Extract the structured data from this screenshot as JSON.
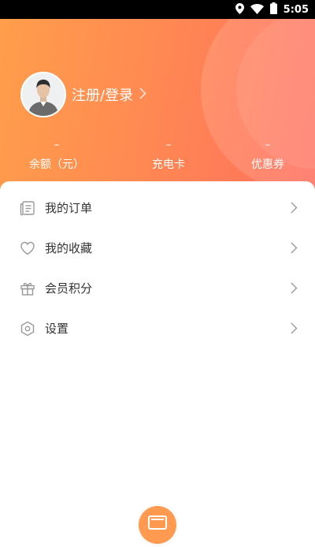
{
  "status_bar": {
    "time": "5:05",
    "icons": [
      "location-icon",
      "wifi-icon",
      "battery-icon"
    ]
  },
  "profile": {
    "login_label": "注册/登录",
    "avatar_icon": "user-avatar-icon"
  },
  "stats": [
    {
      "value": "–",
      "label": "余额（元）"
    },
    {
      "value": "–",
      "label": "充电卡"
    },
    {
      "value": "–",
      "label": "优惠券"
    }
  ],
  "menu": [
    {
      "label": "我的订单",
      "icon": "orders-icon"
    },
    {
      "label": "我的收藏",
      "icon": "heart-icon"
    },
    {
      "label": "会员积分",
      "icon": "gift-icon"
    },
    {
      "label": "设置",
      "icon": "settings-icon"
    }
  ],
  "colors": {
    "header_gradient_start": "#ff9e4b",
    "header_gradient_end": "#ff6f5e",
    "text_primary": "#333333",
    "icon_gray": "#999999",
    "fab": "#ff9a50"
  }
}
